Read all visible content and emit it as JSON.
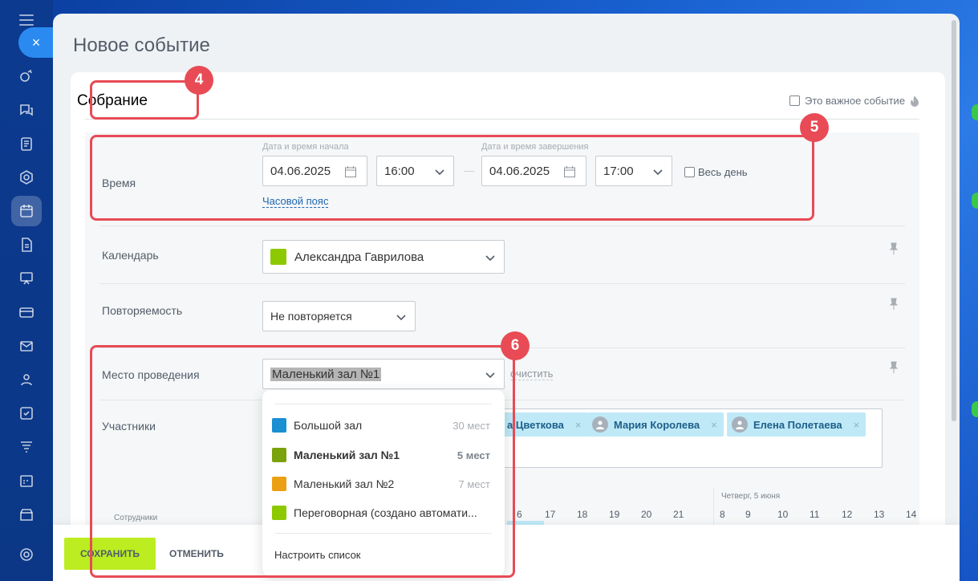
{
  "sidebar": {
    "items": [
      {
        "icon": "feed-icon"
      },
      {
        "icon": "chat-icon"
      },
      {
        "icon": "document-icon"
      },
      {
        "icon": "hexagon-icon"
      },
      {
        "icon": "calendar-icon",
        "active": true
      },
      {
        "icon": "file-icon"
      },
      {
        "icon": "presentation-icon"
      },
      {
        "icon": "card-icon"
      },
      {
        "icon": "mail-icon"
      },
      {
        "icon": "users-icon"
      },
      {
        "icon": "task-icon"
      },
      {
        "icon": "filter-icon"
      },
      {
        "icon": "schedule-icon"
      },
      {
        "icon": "store-icon"
      },
      {
        "icon": "settings-icon"
      }
    ]
  },
  "close_label": "×",
  "panel": {
    "title": "Новое событие",
    "event_name": "Собрание",
    "important_label": "Это важное событие"
  },
  "time": {
    "label": "Время",
    "start_hint": "Дата и время начала",
    "end_hint": "Дата и время завершения",
    "start_date": "04.06.2025",
    "start_time": "16:00",
    "dash": "—",
    "end_date": "04.06.2025",
    "end_time": "17:00",
    "allday_label": "Весь день",
    "timezone_link": "Часовой пояс"
  },
  "calendar": {
    "label": "Календарь",
    "value": "Александра Гаврилова",
    "color": "#8dc900"
  },
  "repeat": {
    "label": "Повторяемость",
    "value": "Не повторяется"
  },
  "location": {
    "label": "Место проведения",
    "value": "Маленький зал №1",
    "clear_link": "очистить",
    "dropdown": {
      "items": [
        {
          "name": "Большой зал",
          "capacity": "30 мест",
          "color": "#1a8fd1"
        },
        {
          "name": "Маленький зал №1",
          "capacity": "5 мест",
          "color": "#7aa20c",
          "selected": true
        },
        {
          "name": "Маленький зал №2",
          "capacity": "7 мест",
          "color": "#eaa012"
        },
        {
          "name": "Переговорная (создано автомати...",
          "capacity": "",
          "color": "#8dc900"
        }
      ],
      "configure_label": "Настроить список"
    }
  },
  "participants": {
    "label": "Участники",
    "chips": [
      {
        "name": "а Цветкова"
      },
      {
        "name": "Мария Королева"
      },
      {
        "name": "Елена Полетаева"
      }
    ],
    "remove_label": "×"
  },
  "timeline": {
    "employees_label": "Сотрудники",
    "day_label": "Четверг, 5 июня",
    "hours_left": [
      "6",
      "17",
      "18",
      "19",
      "20",
      "21"
    ],
    "hours_right": [
      "8",
      "9",
      "10",
      "11",
      "12",
      "13",
      "14"
    ]
  },
  "footer": {
    "save_label": "СОХРАНИТЬ",
    "cancel_label": "ОТМЕНИТЬ"
  },
  "annotations": [
    {
      "number": "4"
    },
    {
      "number": "5"
    },
    {
      "number": "6"
    }
  ],
  "colors": {
    "accent": "#bbed21",
    "annotation": "#e84b55",
    "link": "#2067b0"
  }
}
